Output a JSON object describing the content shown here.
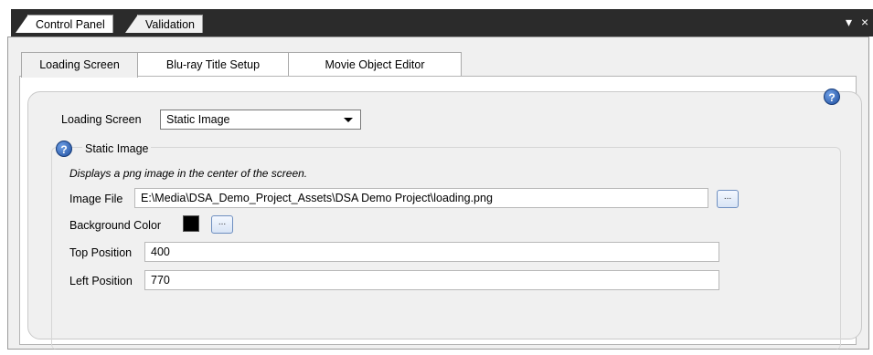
{
  "document_tabs": [
    {
      "label": "Control Panel",
      "active": true
    },
    {
      "label": "Validation",
      "active": false
    }
  ],
  "window_buttons": {
    "dropdown": "▾",
    "close": "×"
  },
  "tabs": [
    {
      "label": "Loading Screen",
      "active": true
    },
    {
      "label": "Blu-ray Title Setup",
      "active": false
    },
    {
      "label": "Movie Object Editor",
      "active": false
    }
  ],
  "help_icon": "?",
  "loading_screen": {
    "label": "Loading Screen",
    "value": "Static Image"
  },
  "static_image": {
    "title": "Static Image",
    "description": "Displays a png image in the center of the screen.",
    "image_file": {
      "label": "Image File",
      "value": "E:\\Media\\DSA_Demo_Project_Assets\\DSA Demo Project\\loading.png",
      "browse": "..."
    },
    "background_color": {
      "label": "Background Color",
      "color": "#000000",
      "browse": "..."
    },
    "top_position": {
      "label": "Top Position",
      "value": "400"
    },
    "left_position": {
      "label": "Left Position",
      "value": "770"
    }
  }
}
